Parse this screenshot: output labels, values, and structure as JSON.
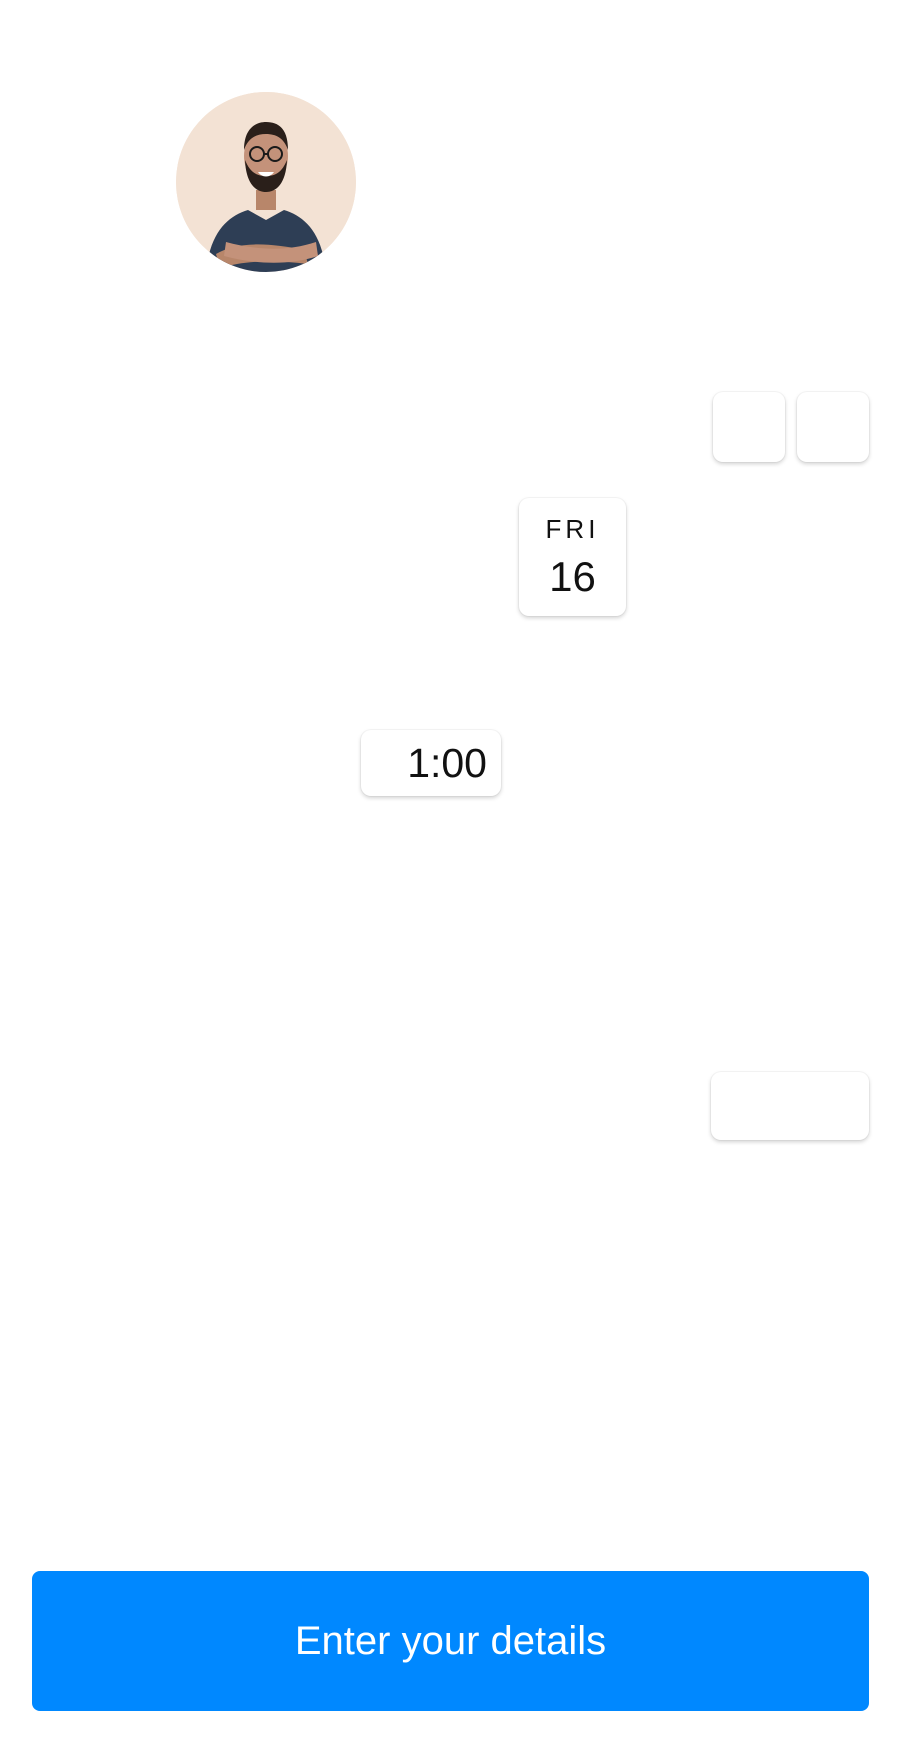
{
  "profile": {
    "avatar_icon": "person-avatar-photo"
  },
  "calendar": {
    "prev_icon": "chevron-left-icon",
    "next_icon": "chevron-right-icon",
    "selected_day": {
      "weekday": "FRI",
      "number": "16"
    }
  },
  "time_slots": [
    {
      "label": "1:00"
    }
  ],
  "cta": {
    "label": "Enter your details",
    "color": "#0088ff"
  }
}
